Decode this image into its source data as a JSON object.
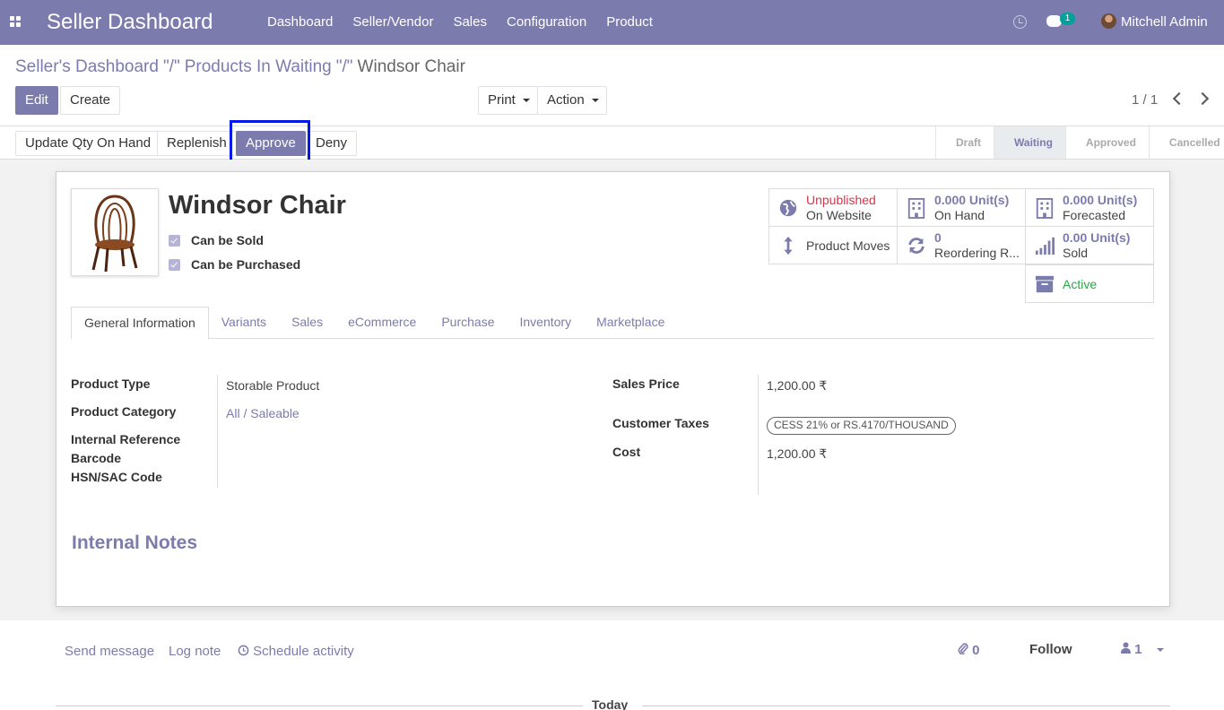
{
  "navbar": {
    "brand": "Seller Dashboard",
    "menu": [
      "Dashboard",
      "Seller/Vendor",
      "Sales",
      "Configuration",
      "Product"
    ],
    "message_count": "1",
    "user": "Mitchell Admin",
    "color": "#7c7bad"
  },
  "breadcrumb": {
    "items": [
      "Seller's Dashboard",
      "Products In Waiting"
    ],
    "separator": "\"/\"",
    "current": "Windsor Chair"
  },
  "actions": {
    "edit": "Edit",
    "create": "Create",
    "print": "Print",
    "action": "Action"
  },
  "pager": {
    "value": "1 / 1"
  },
  "statusbar": {
    "buttons": [
      "Update Qty On Hand",
      "Replenish",
      "Approve",
      "Deny"
    ],
    "stages": [
      "Draft",
      "Waiting",
      "Approved",
      "Cancelled"
    ],
    "active_stage": "Waiting"
  },
  "product": {
    "name": "Windsor Chair",
    "can_be_sold": "Can be Sold",
    "can_be_purchased": "Can be Purchased"
  },
  "smart_buttons": {
    "website": {
      "line1": "Unpublished",
      "line2": "On Website",
      "icon": "globe-icon"
    },
    "on_hand": {
      "line1": "0.000 Unit(s)",
      "line2": "On Hand",
      "icon": "building-icon"
    },
    "forecasted": {
      "line1": "0.000 Unit(s)",
      "line2": "Forecasted",
      "icon": "building-icon"
    },
    "moves": {
      "line1": "Product Moves",
      "icon": "arrows-v-icon"
    },
    "reordering": {
      "line1": "0",
      "line2": "Reordering R...",
      "icon": "refresh-icon"
    },
    "sold": {
      "line1": "0.00 Unit(s)",
      "line2": "Sold",
      "icon": "bar-chart-icon"
    },
    "active": {
      "line1": "Active",
      "icon": "archive-icon"
    }
  },
  "tabs": [
    "General Information",
    "Variants",
    "Sales",
    "eCommerce",
    "Purchase",
    "Inventory",
    "Marketplace"
  ],
  "fields": {
    "product_type": {
      "label": "Product Type",
      "value": "Storable Product"
    },
    "product_category": {
      "label": "Product Category",
      "value": "All / Saleable"
    },
    "internal_reference": {
      "label": "Internal Reference",
      "value": ""
    },
    "barcode": {
      "label": "Barcode",
      "value": ""
    },
    "hsn": {
      "label": "HSN/SAC Code",
      "value": ""
    },
    "sales_price": {
      "label": "Sales Price",
      "value": "1,200.00 ₹"
    },
    "customer_taxes": {
      "label": "Customer Taxes",
      "value": "CESS 21% or RS.4170/THOUSAND"
    },
    "cost": {
      "label": "Cost",
      "value": "1,200.00 ₹"
    }
  },
  "internal_notes": "Internal Notes",
  "chatter": {
    "send_message": "Send message",
    "log_note": "Log note",
    "schedule_activity": "Schedule activity",
    "attachments": "0",
    "follow": "Follow",
    "followers": "1",
    "today": "Today"
  }
}
